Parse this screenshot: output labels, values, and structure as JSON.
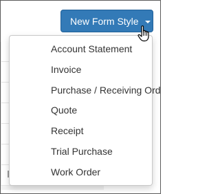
{
  "toolbar": {
    "new_form_style_label": "New Form Style",
    "accent_color": "#337ab7"
  },
  "dropdown": {
    "items": [
      {
        "label": "Account Statement"
      },
      {
        "label": "Invoice"
      },
      {
        "label": "Purchase / Receiving Order"
      },
      {
        "label": "Quote"
      },
      {
        "label": "Receipt"
      },
      {
        "label": "Trial Purchase"
      },
      {
        "label": "Work Order"
      }
    ]
  },
  "icons": {
    "button_caret": "chevron-down-icon",
    "mouse_cursor": "hand-pointer-icon"
  }
}
